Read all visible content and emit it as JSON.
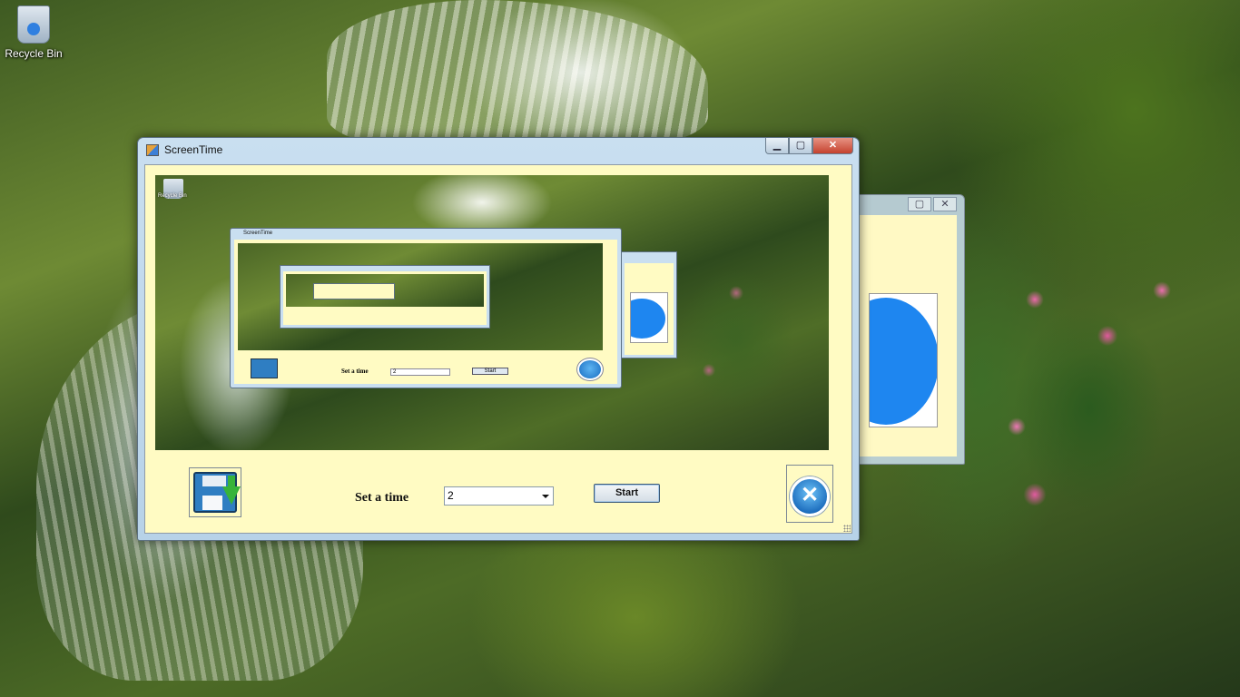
{
  "desktop": {
    "recycle_bin_label": "Recycle Bin"
  },
  "window": {
    "title": "ScreenTime",
    "controls": {
      "minimize": "▁",
      "maximize": "▢",
      "close": "✕"
    }
  },
  "preview": {
    "recycle_bin_label": "Recycle Bin",
    "nested_title": "ScreenTime",
    "nested_set_label": "Set a time",
    "nested_time_value": "2",
    "nested_start_label": "Start"
  },
  "controls": {
    "set_time_label": "Set a time",
    "time_value": "2",
    "start_label": "Start",
    "exit_glyph": "✕"
  },
  "background_window": {
    "close": "✕",
    "maximize": "▢"
  },
  "colors": {
    "client_bg": "#fffbc3",
    "power_blue": "#1e86f0"
  }
}
